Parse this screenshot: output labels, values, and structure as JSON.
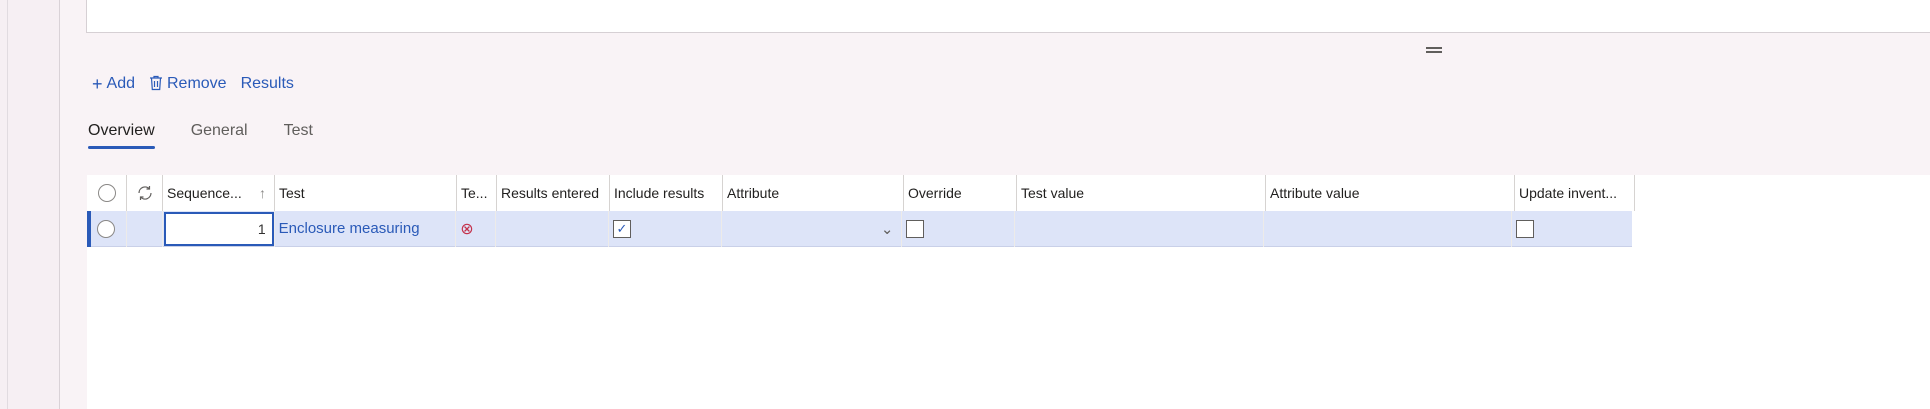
{
  "actions": {
    "add_label": "Add",
    "remove_label": "Remove",
    "results_label": "Results"
  },
  "tabs": [
    {
      "label": "Overview",
      "active": true
    },
    {
      "label": "General",
      "active": false
    },
    {
      "label": "Test",
      "active": false
    }
  ],
  "grid": {
    "columns": [
      "Sequence...",
      "Test",
      "Te...",
      "Results entered",
      "Include results",
      "Attribute",
      "Override",
      "Test value",
      "Attribute value",
      "Update invent..."
    ],
    "rows": [
      {
        "sequence": "1",
        "test": "Enclosure measuring",
        "test_status_icon": "error-circle-icon",
        "results_entered": "",
        "include_results": true,
        "attribute": "",
        "override": false,
        "test_value": "",
        "attribute_value": "",
        "update_inventory": false
      }
    ]
  },
  "colors": {
    "accent": "#2a5ab8",
    "selected_row": "#dde4f8",
    "error": "#c4314b"
  }
}
